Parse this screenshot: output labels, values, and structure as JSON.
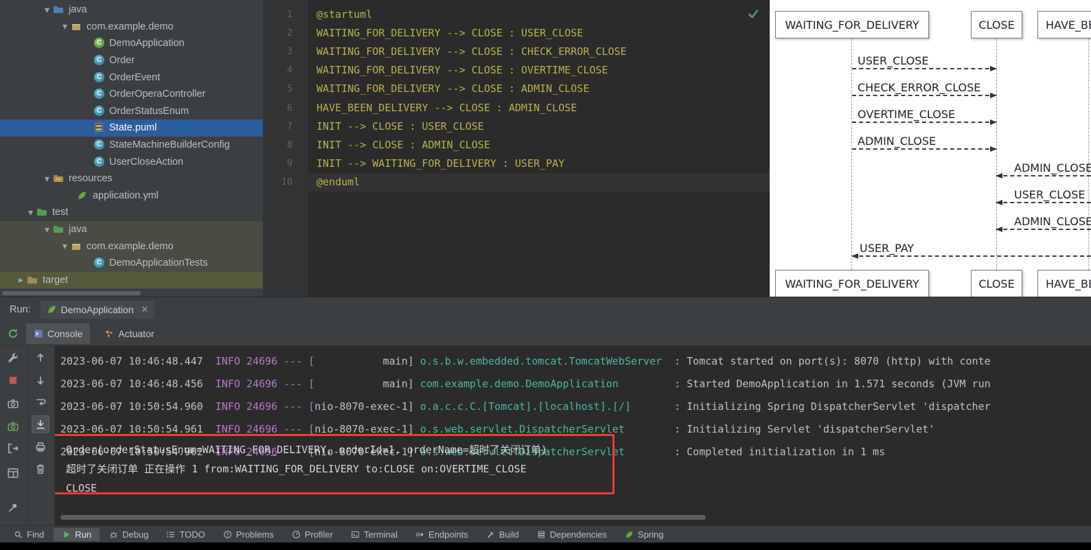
{
  "colors": {
    "selection_blue": "#2D5C9F",
    "highlight_red": "#F03A3A",
    "spring_green": "#6DB33F",
    "info_magenta": "#B878C8",
    "logger_teal": "#4FB5A5",
    "code_yellow": "#B8B24E"
  },
  "project": {
    "rows": [
      {
        "label": "java"
      },
      {
        "label": "com.example.demo"
      },
      {
        "label": "DemoApplication"
      },
      {
        "label": "Order"
      },
      {
        "label": "OrderEvent"
      },
      {
        "label": "OrderOperaController"
      },
      {
        "label": "OrderStatusEnum"
      },
      {
        "label": "State.puml"
      },
      {
        "label": "StateMachineBuilderConfig"
      },
      {
        "label": "UserCloseAction"
      },
      {
        "label": "resources"
      },
      {
        "label": "application.yml"
      },
      {
        "label": "test"
      },
      {
        "label": "java"
      },
      {
        "label": "com.example.demo"
      },
      {
        "label": "DemoApplicationTests"
      },
      {
        "label": "target"
      }
    ]
  },
  "editor": {
    "lines": [
      {
        "no": "1",
        "text": "@startuml"
      },
      {
        "no": "2",
        "text": "WAITING_FOR_DELIVERY --> CLOSE : USER_CLOSE"
      },
      {
        "no": "3",
        "text": "WAITING_FOR_DELIVERY --> CLOSE : CHECK_ERROR_CLOSE"
      },
      {
        "no": "4",
        "text": "WAITING_FOR_DELIVERY --> CLOSE : OVERTIME_CLOSE"
      },
      {
        "no": "5",
        "text": "WAITING_FOR_DELIVERY --> CLOSE : ADMIN_CLOSE"
      },
      {
        "no": "6",
        "text": "HAVE_BEEN_DELIVERY --> CLOSE : ADMIN_CLOSE"
      },
      {
        "no": "7",
        "text": "INIT --> CLOSE : USER_CLOSE"
      },
      {
        "no": "8",
        "text": "INIT --> CLOSE : ADMIN_CLOSE"
      },
      {
        "no": "9",
        "text": "INIT --> WAITING_FOR_DELIVERY : USER_PAY"
      },
      {
        "no": "10",
        "text": "@enduml"
      }
    ]
  },
  "diagram": {
    "participants_top": [
      {
        "label": "WAITING_FOR_DELIVERY"
      },
      {
        "label": "CLOSE"
      },
      {
        "label": "HAVE_BEEN_DELIVERY"
      }
    ],
    "participants_bottom": [
      {
        "label": "WAITING_FOR_DELIVERY"
      },
      {
        "label": "CLOSE"
      },
      {
        "label": "HAVE_BEEN_DELIVERY"
      }
    ],
    "messages_left": [
      {
        "label": "USER_CLOSE"
      },
      {
        "label": "CHECK_ERROR_CLOSE"
      },
      {
        "label": "OVERTIME_CLOSE"
      },
      {
        "label": "ADMIN_CLOSE"
      }
    ],
    "messages_right": [
      {
        "label": "ADMIN_CLOSE"
      },
      {
        "label": "USER_CLOSE"
      },
      {
        "label": "ADMIN_CLOSE"
      }
    ],
    "message_pay": {
      "label": "USER_PAY"
    }
  },
  "run": {
    "label": "Run:",
    "session_tab": "DemoApplication",
    "tabs": [
      {
        "label": "Console"
      },
      {
        "label": "Actuator"
      }
    ],
    "logs": [
      {
        "time": "2023-06-07 10:46:48.447  ",
        "level": "INFO 24696 --- [",
        "thread": "           main] ",
        "logger": "o.s.b.w.embedded.tomcat.TomcatWebServer",
        "msg": "  : Tomcat started on port(s): 8070 (http) with conte"
      },
      {
        "time": "2023-06-07 10:46:48.456  ",
        "level": "INFO 24696 --- [",
        "thread": "           main] ",
        "logger": "com.example.demo.DemoApplication",
        "msg": "         : Started DemoApplication in 1.571 seconds (JVM run"
      },
      {
        "time": "2023-06-07 10:50:54.960  ",
        "level": "INFO 24696 --- [",
        "thread": "nio-8070-exec-1] ",
        "logger": "o.a.c.c.C.[Tomcat].[localhost].[/]",
        "msg": "       : Initializing Spring DispatcherServlet 'dispatcher"
      },
      {
        "time": "2023-06-07 10:50:54.961  ",
        "level": "INFO 24696 --- [",
        "thread": "nio-8070-exec-1] ",
        "logger": "o.s.web.servlet.DispatcherServlet",
        "msg": "        : Initializing Servlet 'dispatcherServlet'"
      },
      {
        "time": "2023-06-07 10:50:54.962  ",
        "level": "INFO 24696 --- [",
        "thread": "nio-8070-exec-1] ",
        "logger": "o.s.web.servlet.DispatcherServlet",
        "msg": "        : Completed initialization in 1 ms"
      }
    ],
    "highlight": {
      "lines": [
        {
          "text": "Order(orderStatusEnum=WAITING_FOR_DELIVERY, orderId=1, orderName=超时了关闭订单)"
        },
        {
          "text": "超时了关闭订单 正在操作 1 from:WAITING_FOR_DELIVERY to:CLOSE on:OVERTIME_CLOSE"
        },
        {
          "text": "CLOSE"
        }
      ]
    }
  },
  "bottom_bar": {
    "items": [
      {
        "label": "Find"
      },
      {
        "label": "Run"
      },
      {
        "label": "Debug"
      },
      {
        "label": "TODO"
      },
      {
        "label": "Problems"
      },
      {
        "label": "Profiler"
      },
      {
        "label": "Terminal"
      },
      {
        "label": "Endpoints"
      },
      {
        "label": "Build"
      },
      {
        "label": "Dependencies"
      },
      {
        "label": "Spring"
      }
    ]
  }
}
